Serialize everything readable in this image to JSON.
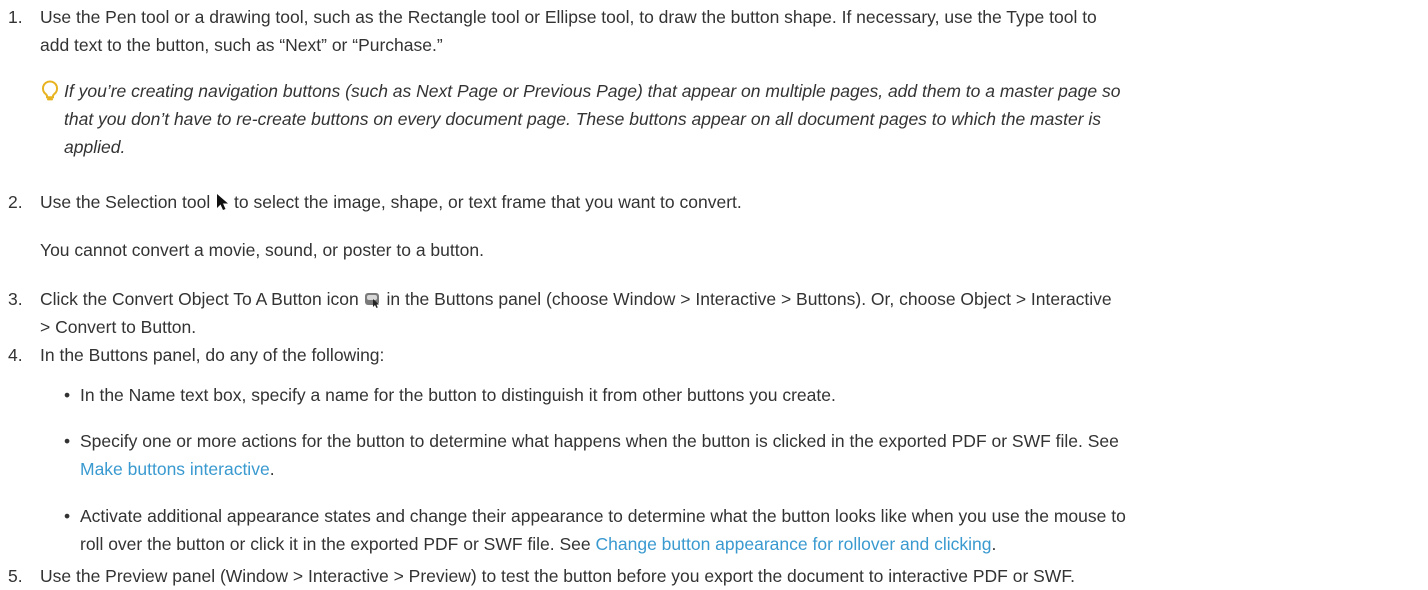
{
  "steps": [
    {
      "number": "1.",
      "lines": [
        "Use the Pen tool or a drawing tool, such as the Rectangle tool or Ellipse tool, to draw the button shape. If necessary, use the Type tool to",
        "add text to the button, such as “Next” or “Purchase.”"
      ],
      "tip": [
        "If you’re creating navigation buttons (such as Next Page or Previous Page) that appear on multiple pages, add them to a master page so",
        "that you don’t have to re-create buttons on every document page. These buttons appear on all document pages to which the master is",
        "applied."
      ]
    },
    {
      "number": "2.",
      "text_before_icon": "Use the Selection tool",
      "icon": "selection-arrow-icon",
      "text_after_icon": " to select the image, shape, or text frame that you want to convert.",
      "note": "You cannot convert a movie, sound, or poster to a button."
    },
    {
      "number": "3.",
      "text_before_icon": "Click the Convert Object To A Button icon",
      "icon": "convert-to-button-icon",
      "text_after_icon": " in the Buttons panel (choose Window > Interactive > Buttons). Or, choose Object > Interactive",
      "line2": "> Convert to Button."
    },
    {
      "number": "4.",
      "text": "In the Buttons panel, do any of the following:",
      "bullets": [
        {
          "lines": [
            "In the Name text box, specify a name for the button to distinguish it from other buttons you create."
          ]
        },
        {
          "line1": "Specify one or more actions for the button to determine what happens when the button is clicked in the exported PDF or SWF file. See",
          "link": "Make buttons interactive",
          "after_link": "."
        },
        {
          "line1": "Activate additional appearance states and change their appearance to determine what the button looks like when you use the mouse to",
          "line2_before": "roll over the button or click it in the exported PDF or SWF file. See ",
          "link": "Change button appearance for rollover and clicking",
          "after_link": "."
        }
      ]
    },
    {
      "number": "5.",
      "text": "Use the Preview panel (Window > Interactive > Preview) to test the button before you export the document to interactive PDF or SWF."
    }
  ],
  "colors": {
    "text": "#333333",
    "link": "#3a9ad0",
    "tip_icon": "#e8b320"
  }
}
